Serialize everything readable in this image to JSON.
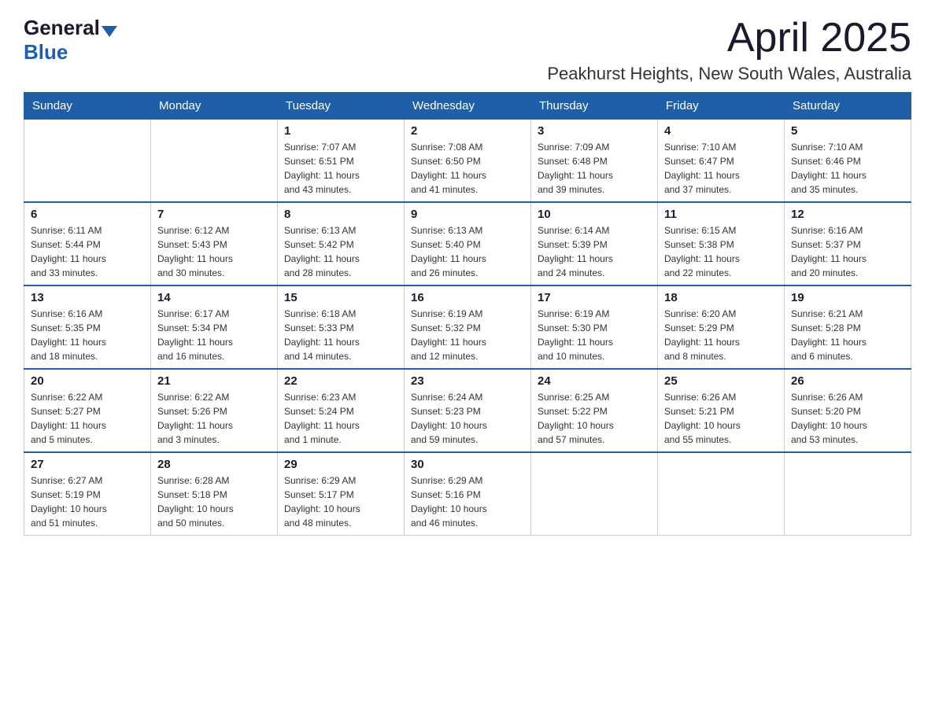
{
  "logo": {
    "general": "General",
    "blue": "Blue"
  },
  "title": "April 2025",
  "location": "Peakhurst Heights, New South Wales, Australia",
  "days_of_week": [
    "Sunday",
    "Monday",
    "Tuesday",
    "Wednesday",
    "Thursday",
    "Friday",
    "Saturday"
  ],
  "weeks": [
    [
      {
        "day": "",
        "info": ""
      },
      {
        "day": "",
        "info": ""
      },
      {
        "day": "1",
        "info": "Sunrise: 7:07 AM\nSunset: 6:51 PM\nDaylight: 11 hours\nand 43 minutes."
      },
      {
        "day": "2",
        "info": "Sunrise: 7:08 AM\nSunset: 6:50 PM\nDaylight: 11 hours\nand 41 minutes."
      },
      {
        "day": "3",
        "info": "Sunrise: 7:09 AM\nSunset: 6:48 PM\nDaylight: 11 hours\nand 39 minutes."
      },
      {
        "day": "4",
        "info": "Sunrise: 7:10 AM\nSunset: 6:47 PM\nDaylight: 11 hours\nand 37 minutes."
      },
      {
        "day": "5",
        "info": "Sunrise: 7:10 AM\nSunset: 6:46 PM\nDaylight: 11 hours\nand 35 minutes."
      }
    ],
    [
      {
        "day": "6",
        "info": "Sunrise: 6:11 AM\nSunset: 5:44 PM\nDaylight: 11 hours\nand 33 minutes."
      },
      {
        "day": "7",
        "info": "Sunrise: 6:12 AM\nSunset: 5:43 PM\nDaylight: 11 hours\nand 30 minutes."
      },
      {
        "day": "8",
        "info": "Sunrise: 6:13 AM\nSunset: 5:42 PM\nDaylight: 11 hours\nand 28 minutes."
      },
      {
        "day": "9",
        "info": "Sunrise: 6:13 AM\nSunset: 5:40 PM\nDaylight: 11 hours\nand 26 minutes."
      },
      {
        "day": "10",
        "info": "Sunrise: 6:14 AM\nSunset: 5:39 PM\nDaylight: 11 hours\nand 24 minutes."
      },
      {
        "day": "11",
        "info": "Sunrise: 6:15 AM\nSunset: 5:38 PM\nDaylight: 11 hours\nand 22 minutes."
      },
      {
        "day": "12",
        "info": "Sunrise: 6:16 AM\nSunset: 5:37 PM\nDaylight: 11 hours\nand 20 minutes."
      }
    ],
    [
      {
        "day": "13",
        "info": "Sunrise: 6:16 AM\nSunset: 5:35 PM\nDaylight: 11 hours\nand 18 minutes."
      },
      {
        "day": "14",
        "info": "Sunrise: 6:17 AM\nSunset: 5:34 PM\nDaylight: 11 hours\nand 16 minutes."
      },
      {
        "day": "15",
        "info": "Sunrise: 6:18 AM\nSunset: 5:33 PM\nDaylight: 11 hours\nand 14 minutes."
      },
      {
        "day": "16",
        "info": "Sunrise: 6:19 AM\nSunset: 5:32 PM\nDaylight: 11 hours\nand 12 minutes."
      },
      {
        "day": "17",
        "info": "Sunrise: 6:19 AM\nSunset: 5:30 PM\nDaylight: 11 hours\nand 10 minutes."
      },
      {
        "day": "18",
        "info": "Sunrise: 6:20 AM\nSunset: 5:29 PM\nDaylight: 11 hours\nand 8 minutes."
      },
      {
        "day": "19",
        "info": "Sunrise: 6:21 AM\nSunset: 5:28 PM\nDaylight: 11 hours\nand 6 minutes."
      }
    ],
    [
      {
        "day": "20",
        "info": "Sunrise: 6:22 AM\nSunset: 5:27 PM\nDaylight: 11 hours\nand 5 minutes."
      },
      {
        "day": "21",
        "info": "Sunrise: 6:22 AM\nSunset: 5:26 PM\nDaylight: 11 hours\nand 3 minutes."
      },
      {
        "day": "22",
        "info": "Sunrise: 6:23 AM\nSunset: 5:24 PM\nDaylight: 11 hours\nand 1 minute."
      },
      {
        "day": "23",
        "info": "Sunrise: 6:24 AM\nSunset: 5:23 PM\nDaylight: 10 hours\nand 59 minutes."
      },
      {
        "day": "24",
        "info": "Sunrise: 6:25 AM\nSunset: 5:22 PM\nDaylight: 10 hours\nand 57 minutes."
      },
      {
        "day": "25",
        "info": "Sunrise: 6:26 AM\nSunset: 5:21 PM\nDaylight: 10 hours\nand 55 minutes."
      },
      {
        "day": "26",
        "info": "Sunrise: 6:26 AM\nSunset: 5:20 PM\nDaylight: 10 hours\nand 53 minutes."
      }
    ],
    [
      {
        "day": "27",
        "info": "Sunrise: 6:27 AM\nSunset: 5:19 PM\nDaylight: 10 hours\nand 51 minutes."
      },
      {
        "day": "28",
        "info": "Sunrise: 6:28 AM\nSunset: 5:18 PM\nDaylight: 10 hours\nand 50 minutes."
      },
      {
        "day": "29",
        "info": "Sunrise: 6:29 AM\nSunset: 5:17 PM\nDaylight: 10 hours\nand 48 minutes."
      },
      {
        "day": "30",
        "info": "Sunrise: 6:29 AM\nSunset: 5:16 PM\nDaylight: 10 hours\nand 46 minutes."
      },
      {
        "day": "",
        "info": ""
      },
      {
        "day": "",
        "info": ""
      },
      {
        "day": "",
        "info": ""
      }
    ]
  ]
}
